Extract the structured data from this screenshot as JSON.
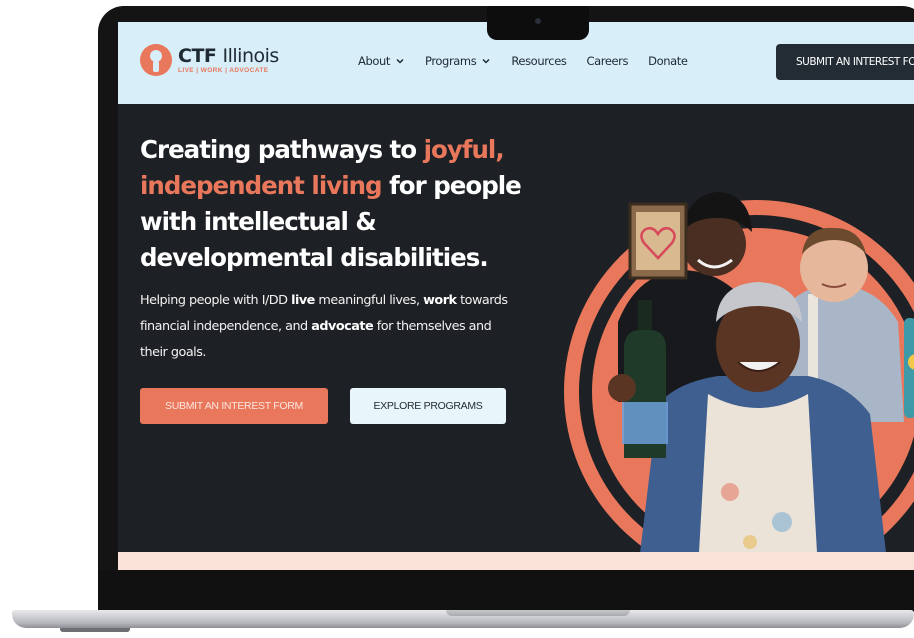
{
  "header": {
    "logo_title": "CTF",
    "logo_title_suffix": "Illinois",
    "logo_tagline": "LIVE | WORK | ADVOCATE",
    "nav": [
      {
        "label": "About",
        "has_dropdown": true
      },
      {
        "label": "Programs",
        "has_dropdown": true
      },
      {
        "label": "Resources",
        "has_dropdown": false
      },
      {
        "label": "Careers",
        "has_dropdown": false
      },
      {
        "label": "Donate",
        "has_dropdown": false
      }
    ],
    "cta_label": "SUBMIT AN INTEREST FORM"
  },
  "hero": {
    "headline_part1": "Creating pathways to ",
    "headline_accent": "joyful, independent living",
    "headline_part2": " for people with intellectual & developmental disabilities.",
    "sub_part1": "Helping people with I/DD ",
    "sub_bold1": "live",
    "sub_part2": " meaningful lives, ",
    "sub_bold2": "work",
    "sub_part3": " towards financial independence, and ",
    "sub_bold3": "advocate",
    "sub_part4": " for themselves and their goals.",
    "primary_button": "SUBMIT AN INTEREST FORM",
    "secondary_button": "EXPLORE PROGRAMS"
  },
  "colors": {
    "accent": "#e8775c",
    "dark": "#1d2024",
    "header_bg": "#d8eef9",
    "button_dark": "#232c35"
  },
  "icons": [
    "logo-person-icon",
    "chevron-down-icon",
    "heart-icon"
  ]
}
